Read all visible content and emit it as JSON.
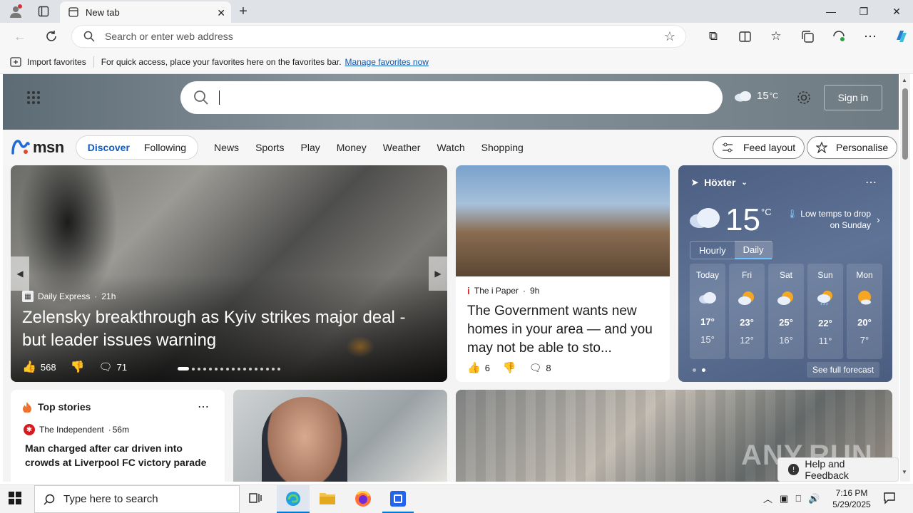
{
  "browser": {
    "tab_title": "New tab",
    "address_placeholder": "Search or enter web address",
    "favorites": {
      "import_label": "Import favorites",
      "hint": "For quick access, place your favorites here on the favorites bar.",
      "manage_link": "Manage favorites now"
    }
  },
  "msn": {
    "logo": "msn",
    "temp": "15",
    "temp_unit": "°C",
    "sign_in": "Sign in",
    "tabs": [
      "Discover",
      "Following"
    ],
    "nav": [
      "News",
      "Sports",
      "Play",
      "Money",
      "Weather",
      "Watch",
      "Shopping"
    ],
    "feed_layout": "Feed layout",
    "personalise": "Personalise"
  },
  "hero": {
    "source": "Daily Express",
    "age": "21h",
    "headline": "Zelensky breakthrough as Kyiv strikes major deal - but leader issues warning",
    "likes": "568",
    "comments": "71"
  },
  "card2": {
    "source": "The i Paper",
    "age": "9h",
    "headline": "The Government wants new homes in your area — and you may not be able to sto...",
    "likes": "6",
    "comments": "8"
  },
  "weather": {
    "location": "Höxter",
    "temp": "15",
    "unit": "°C",
    "alert": "Low temps to drop on Sunday",
    "toggle": [
      "Hourly",
      "Daily"
    ],
    "days": [
      {
        "name": "Today",
        "hi": "17°",
        "lo": "15°"
      },
      {
        "name": "Fri",
        "hi": "23°",
        "lo": "12°"
      },
      {
        "name": "Sat",
        "hi": "25°",
        "lo": "16°"
      },
      {
        "name": "Sun",
        "hi": "22°",
        "lo": "11°"
      },
      {
        "name": "Mon",
        "hi": "20°",
        "lo": "7°"
      }
    ],
    "see_full": "See full forecast"
  },
  "top_stories": {
    "title": "Top stories",
    "source": "The Independent",
    "age": "56m",
    "headline": "Man charged after car driven into crowds at Liverpool FC victory parade"
  },
  "help_feedback": "Help and Feedback",
  "watermark": "ANY.RUN",
  "taskbar": {
    "search_placeholder": "Type here to search",
    "time": "7:16 PM",
    "date": "5/29/2025"
  }
}
